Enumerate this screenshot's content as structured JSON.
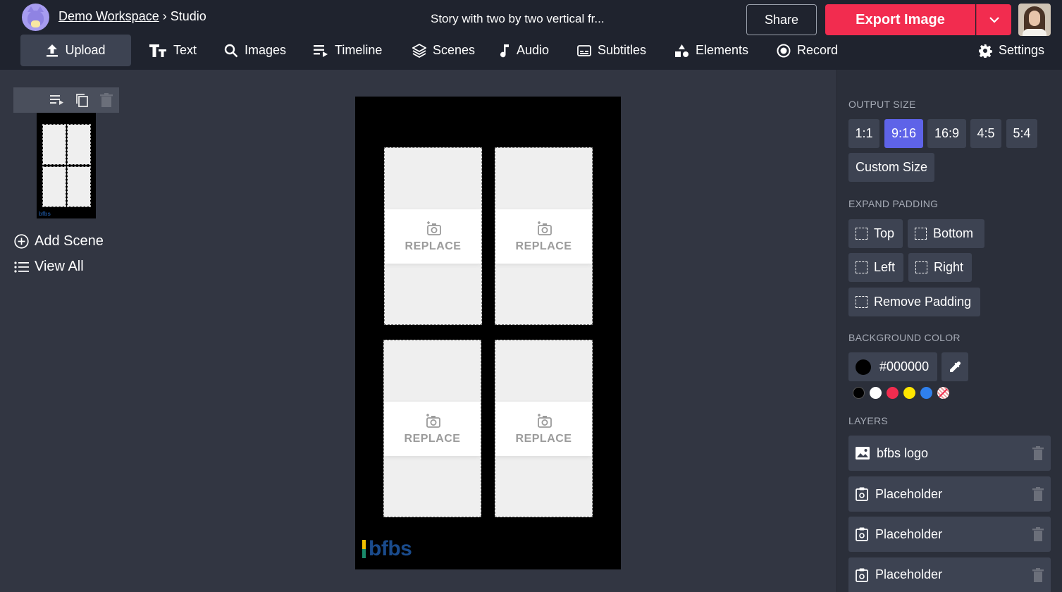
{
  "header": {
    "workspace": "Demo Workspace",
    "separator": "›",
    "section": "Studio",
    "doc_title": "Story with two by two vertical fr...",
    "share_label": "Share",
    "export_label": "Export Image"
  },
  "nav": [
    {
      "label": "Upload",
      "icon": "upload-icon"
    },
    {
      "label": "Text",
      "icon": "text-icon"
    },
    {
      "label": "Images",
      "icon": "search-icon"
    },
    {
      "label": "Timeline",
      "icon": "timeline-icon"
    },
    {
      "label": "Scenes",
      "icon": "layers-icon"
    },
    {
      "label": "Audio",
      "icon": "music-note-icon"
    },
    {
      "label": "Subtitles",
      "icon": "subtitles-icon"
    },
    {
      "label": "Elements",
      "icon": "shapes-icon"
    },
    {
      "label": "Record",
      "icon": "record-icon"
    },
    {
      "label": "Settings",
      "icon": "gear-icon"
    }
  ],
  "scenes": {
    "add_label": "Add Scene",
    "view_all_label": "View All",
    "thumb_logo": "bfbs"
  },
  "canvas": {
    "replace_label": "REPLACE",
    "logo_text": "bfbs",
    "background": "#000000"
  },
  "output_size": {
    "title": "OUTPUT SIZE",
    "options": [
      "1:1",
      "9:16",
      "16:9",
      "4:5",
      "5:4"
    ],
    "selected": "9:16",
    "custom_label": "Custom Size"
  },
  "expand_padding": {
    "title": "EXPAND PADDING",
    "top": "Top",
    "bottom": "Bottom",
    "left": "Left",
    "right": "Right",
    "remove": "Remove Padding"
  },
  "background_color": {
    "title": "BACKGROUND COLOR",
    "value": "#000000",
    "presets": [
      "#000000",
      "#ffffff",
      "#f22c4f",
      "#ffe600",
      "#2f80ed",
      "transparent"
    ]
  },
  "layers": {
    "title": "LAYERS",
    "items": [
      {
        "label": "bfbs logo",
        "icon": "image-icon"
      },
      {
        "label": "Placeholder",
        "icon": "placeholder-icon"
      },
      {
        "label": "Placeholder",
        "icon": "placeholder-icon"
      },
      {
        "label": "Placeholder",
        "icon": "placeholder-icon"
      }
    ]
  },
  "colors": {
    "accent": "#5e63e8",
    "export": "#f22c4f",
    "topbar": "#1f232e",
    "panel": "#2b2f3a"
  }
}
